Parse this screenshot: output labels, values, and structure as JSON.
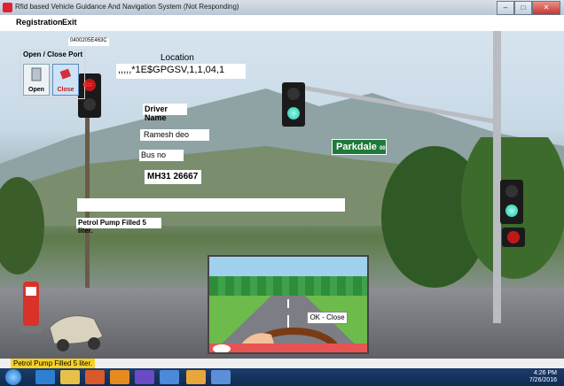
{
  "window": {
    "title": "Rfid based Vehicle Guidance And Navigation System (Not Responding)"
  },
  "menu": {
    "registration": "Registration",
    "exit": "Exit"
  },
  "tag_id": "0400205E463C",
  "port": {
    "group_title": "Open / Close Port",
    "open_label": "Open",
    "close_label": "Close"
  },
  "location": {
    "label": "Location",
    "value": ",,,,,*1E$GPGSV,1,1,04,1"
  },
  "driver": {
    "label": "Driver Name",
    "value": "Ramesh deo"
  },
  "bus": {
    "label": "Bus no",
    "value": "MH31 26667"
  },
  "street_sign": {
    "name": "Parkdale",
    "block": "00"
  },
  "message": "Petrol Pump Filled 5 liter.",
  "dialog": {
    "ok_label": "OK - Close"
  },
  "status_text": "Petrol Pump Filled 5 liter.",
  "tray": {
    "time": "4:26 PM",
    "date": "7/26/2016"
  },
  "colors": {
    "signal_green": "#18c6a6",
    "signal_red": "#c01818",
    "status_highlight": "#f5d22a",
    "taskbar": "#1c3c6a"
  }
}
